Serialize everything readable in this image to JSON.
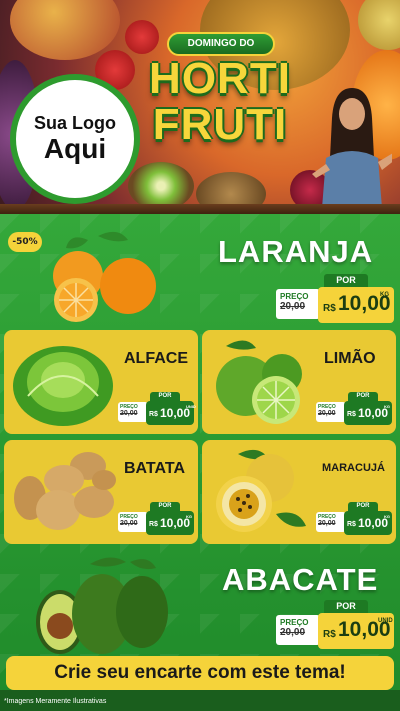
{
  "logo": {
    "line1": "Sua Logo",
    "line2": "Aqui"
  },
  "title": {
    "badge": "DOMINGO DO",
    "line1": "HORTI",
    "line2": "FRUTI"
  },
  "featured_badge": "-50%",
  "labels": {
    "por": "POR",
    "preco": "PREÇO",
    "currency": "R$"
  },
  "products": {
    "laranja": {
      "name": "LARANJA",
      "old": "20,00",
      "price": "10,00",
      "unit": "KG"
    },
    "alface": {
      "name": "ALFACE",
      "old": "20,00",
      "price": "10,00",
      "unit": "UNID"
    },
    "limao": {
      "name": "LIMÃO",
      "old": "20,00",
      "price": "10,00",
      "unit": "KG"
    },
    "batata": {
      "name": "BATATA",
      "old": "20,00",
      "price": "10,00",
      "unit": "KG"
    },
    "maracuja": {
      "name": "MARACUJÁ",
      "old": "20,00",
      "price": "10,00",
      "unit": "KG"
    },
    "abacate": {
      "name": "ABACATE",
      "old": "20,00",
      "price": "10,00",
      "unit": "UNID"
    }
  },
  "cta": "Crie seu encarte com este tema!",
  "footnote": "*Imagens Meramente Ilustrativas",
  "colors": {
    "green": "#1f8a2a",
    "yellow": "#f5d33a",
    "card": "#e9c933",
    "dark_green": "#1e7a23"
  }
}
